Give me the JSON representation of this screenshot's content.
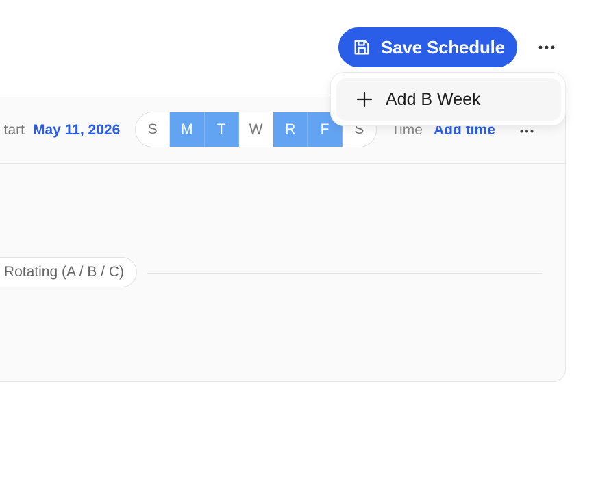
{
  "toolbar": {
    "save_label": "Save Schedule",
    "save_icon": "floppy-disk-icon",
    "more_icon": "ellipsis-horizontal-icon"
  },
  "menu": {
    "items": [
      {
        "label": "Add B Week",
        "icon": "plus-icon"
      }
    ]
  },
  "schedule": {
    "start_label": "tart",
    "start_date": "May 11, 2026",
    "days": [
      {
        "letter": "S",
        "selected": false
      },
      {
        "letter": "M",
        "selected": true
      },
      {
        "letter": "T",
        "selected": true
      },
      {
        "letter": "W",
        "selected": false
      },
      {
        "letter": "R",
        "selected": true
      },
      {
        "letter": "F",
        "selected": true
      },
      {
        "letter": "S",
        "selected": false
      }
    ],
    "time_label": "Time",
    "add_time_label": "Add time",
    "rotation_label": "Rotating (A / B / C)"
  },
  "colors": {
    "primary": "#2a5ee8",
    "day_selected": "#63a4f2",
    "card_bg": "#fafafa",
    "border": "#e6e6e6"
  }
}
